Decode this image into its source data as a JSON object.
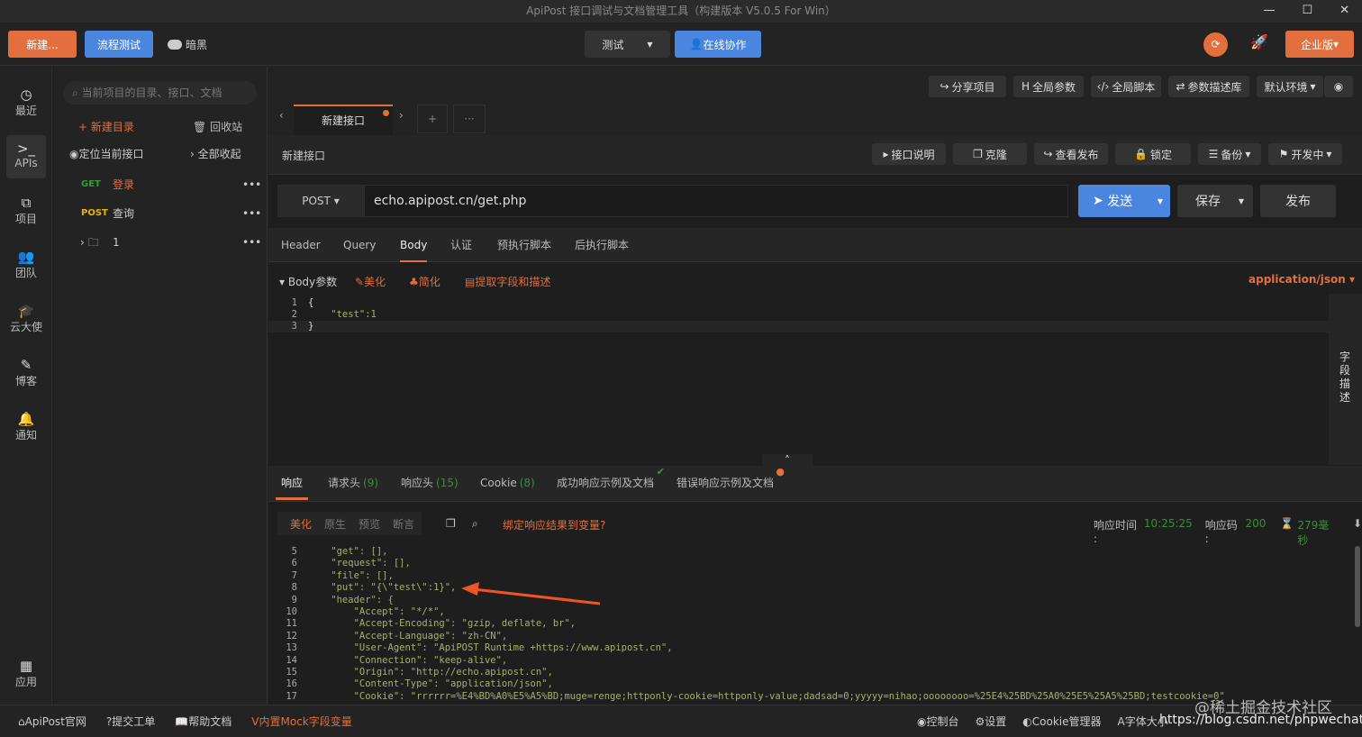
{
  "window": {
    "title": "ApiPost 接口调试与文档管理工具（构建版本 V5.0.5 For Win）",
    "min": "—",
    "max": "☐",
    "close": "✕"
  },
  "toolbar": {
    "new": "新建...",
    "flow_test": "流程测试",
    "dark_toggle": "暗黑",
    "env": "测试",
    "collab": "在线协作",
    "enterprise": "企业版"
  },
  "global_buttons": [
    "分享项目",
    "全局参数",
    "全局脚本",
    "参数描述库",
    "默认环境"
  ],
  "leftnav": [
    {
      "icon": "clock-icon",
      "label": "最近"
    },
    {
      "icon": "terminal-icon",
      "label": "APIs"
    },
    {
      "icon": "project-icon",
      "label": "项目"
    },
    {
      "icon": "team-icon",
      "label": "团队"
    },
    {
      "icon": "graduation-cap-icon",
      "label": "云大使"
    },
    {
      "icon": "edit-icon",
      "label": "博客"
    },
    {
      "icon": "bell-icon",
      "label": "通知"
    },
    {
      "icon": "apps-icon",
      "label": "应用"
    }
  ],
  "tree": {
    "search_placeholder": "当前项目的目录、接口、文档",
    "new_folder": "新建目录",
    "recycle": "回收站",
    "locate": "定位当前接口",
    "collapse": "全部收起",
    "items": [
      {
        "method": "GET",
        "name": "登录",
        "color": "#3a9a3a"
      },
      {
        "method": "POST",
        "name": "查询",
        "color": "#e8b400"
      },
      {
        "method": "",
        "name": "1"
      }
    ]
  },
  "tabs": {
    "active": "新建接口"
  },
  "api": {
    "name": "新建接口",
    "actions": [
      "接口说明",
      "克隆",
      "查看发布",
      "锁定",
      "备份",
      "开发中"
    ],
    "method": "POST",
    "url": "echo.apipost.cn/get.php",
    "send": "发送",
    "save": "保存",
    "publish": "发布"
  },
  "req_tabs": [
    "Header",
    "Query",
    "Body",
    "认证",
    "预执行脚本",
    "后执行脚本"
  ],
  "body": {
    "label": "Body参数",
    "beautify": "美化",
    "simplify": "简化",
    "extract": "提取字段和描述",
    "content_type": "application/json",
    "side": "字段描述",
    "lines": [
      {
        "n": "1",
        "t": "{"
      },
      {
        "n": "2",
        "t": "    \"test\":1"
      },
      {
        "n": "3",
        "t": "}"
      }
    ]
  },
  "resp_tabs": [
    {
      "label": "响应",
      "count": ""
    },
    {
      "label": "请求头",
      "count": "(9)"
    },
    {
      "label": "响应头",
      "count": "(15)"
    },
    {
      "label": "Cookie",
      "count": "(8)"
    },
    {
      "label": "成功响应示例及文档",
      "count": ""
    },
    {
      "label": "错误响应示例及文档",
      "count": ""
    }
  ],
  "resp_bar": {
    "modes": [
      "美化",
      "原生",
      "预览",
      "断言"
    ],
    "bind": "绑定响应结果到变量?",
    "time_label": "响应时间 :",
    "time": "10:25:25",
    "code_label": "响应码 :",
    "code": "200",
    "duration": "279毫秒"
  },
  "resp_lines": [
    {
      "n": "5",
      "t": "    \"get\": [],"
    },
    {
      "n": "6",
      "t": "    \"request\": [],"
    },
    {
      "n": "7",
      "t": "    \"file\": [],"
    },
    {
      "n": "8",
      "t": "    \"put\": \"{\\\"test\\\":1}\","
    },
    {
      "n": "9",
      "t": "    \"header\": {"
    },
    {
      "n": "10",
      "t": "        \"Accept\": \"*/*\","
    },
    {
      "n": "11",
      "t": "        \"Accept-Encoding\": \"gzip, deflate, br\","
    },
    {
      "n": "12",
      "t": "        \"Accept-Language\": \"zh-CN\","
    },
    {
      "n": "13",
      "t": "        \"User-Agent\": \"ApiPOST Runtime +https://www.apipost.cn\","
    },
    {
      "n": "14",
      "t": "        \"Connection\": \"keep-alive\","
    },
    {
      "n": "15",
      "t": "        \"Origin\": \"http://echo.apipost.cn\","
    },
    {
      "n": "16",
      "t": "        \"Content-Type\": \"application/json\","
    },
    {
      "n": "17",
      "t": "        \"Cookie\": \"rrrrrr=%E4%BD%A0%E5%A5%BD;muge=renge;httponly-cookie=httponly-value;dadsad=0;yyyyy=nihao;oooooooo=%25E4%25BD%25A0%25E5%25A5%25BD;testcookie=0\""
    }
  ],
  "status": {
    "left": [
      "ApiPost官网",
      "提交工单",
      "帮助文档",
      "内置Mock字段变量"
    ],
    "right": [
      "控制台",
      "设置",
      "Cookie管理器",
      "字体大小"
    ],
    "watermark": "@稀土掘金技术社区",
    "url_watermark": "https://blog.csdn.net/phpwechat"
  }
}
